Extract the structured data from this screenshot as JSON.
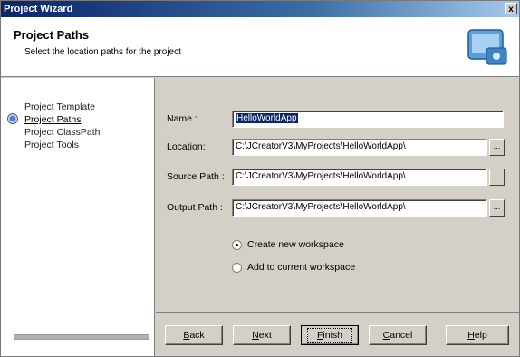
{
  "window": {
    "title": "Project Wizard",
    "close_glyph": "x"
  },
  "header": {
    "title": "Project Paths",
    "subtitle": "Select the location paths for the project",
    "icon": "wizard-icon"
  },
  "steps": [
    {
      "label": "Project Template",
      "active": false
    },
    {
      "label": "Project Paths",
      "active": true
    },
    {
      "label": "Project ClassPath",
      "active": false
    },
    {
      "label": "Project Tools",
      "active": false
    }
  ],
  "form": {
    "name": {
      "label": "Name :",
      "value": "HelloWorldApp"
    },
    "location": {
      "label": "Location:",
      "value": "C:\\JCreatorV3\\MyProjects\\HelloWorldApp\\",
      "browse": "..."
    },
    "source": {
      "label": "Source Path :",
      "value": "C:\\JCreatorV3\\MyProjects\\HelloWorldApp\\",
      "browse": "..."
    },
    "output": {
      "label": "Output Path :",
      "value": "C:\\JCreatorV3\\MyProjects\\HelloWorldApp\\",
      "browse": "..."
    },
    "workspace": {
      "create_label": "Create new workspace",
      "add_label": "Add to current workspace",
      "selected": "create"
    }
  },
  "buttons": {
    "back": {
      "u": "B",
      "rest": "ack"
    },
    "next": {
      "u": "N",
      "rest": "ext"
    },
    "finish": {
      "u": "F",
      "rest": "inish"
    },
    "cancel": {
      "u": "C",
      "rest": "ancel"
    },
    "help": {
      "u": "H",
      "rest": "elp"
    }
  }
}
